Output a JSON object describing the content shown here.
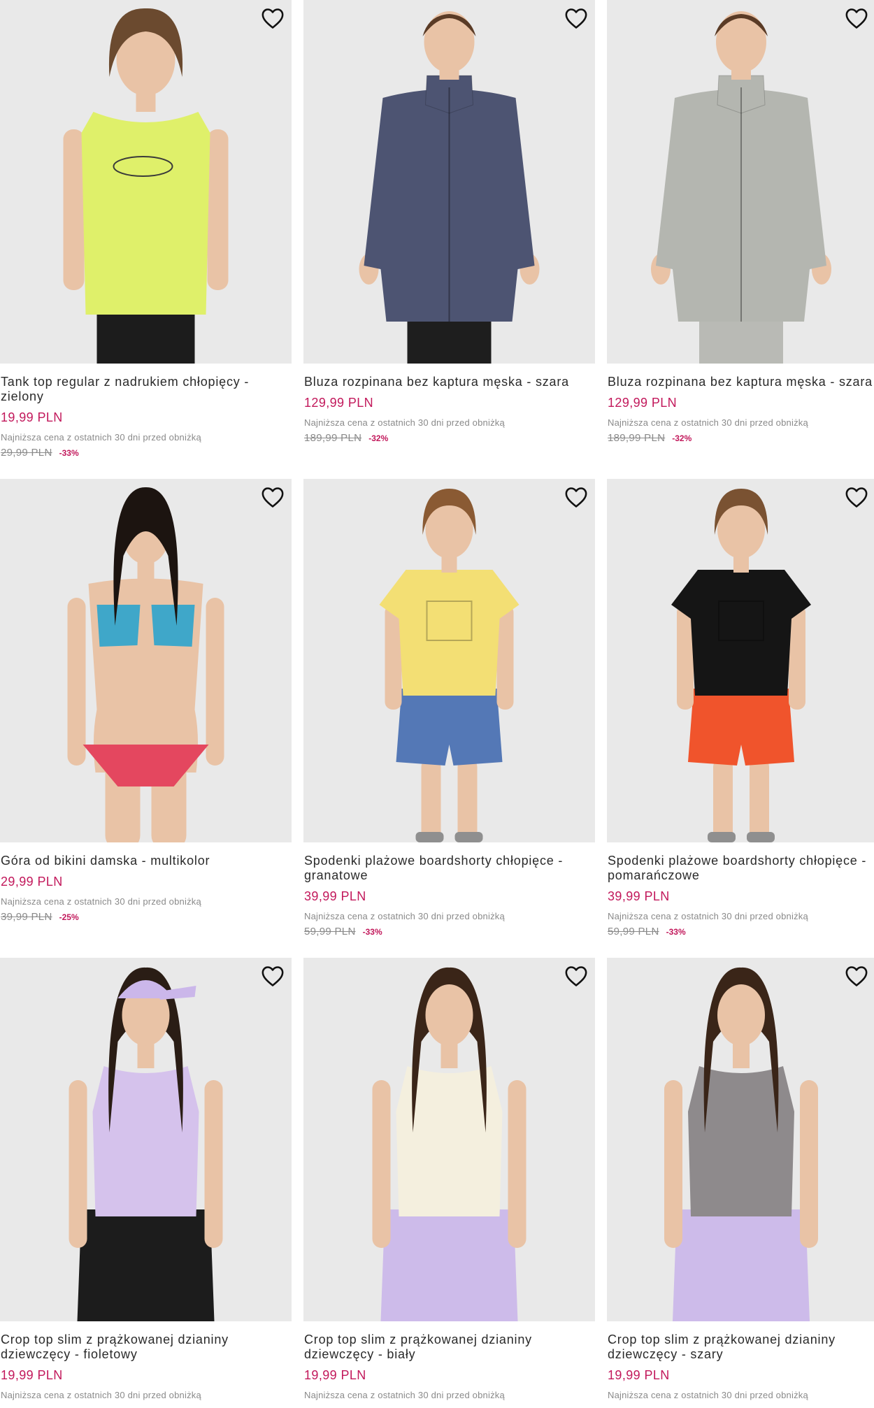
{
  "products": [
    {
      "title": "Tank top regular z nadrukiem chłopięcy - zielony",
      "price": "19,99 PLN",
      "lowest_label": "Najniższa cena z ostatnich 30 dni przed obniżką",
      "old_price": "29,99 PLN",
      "discount": "-33%",
      "image_kind": "kid-tank",
      "top_color": "#dff06a",
      "bottom_color": "#1c1c1c",
      "hair_color": "#6b4a2f"
    },
    {
      "title": "Bluza rozpinana bez kaptura męska - szara",
      "price": "129,99 PLN",
      "lowest_label": "Najniższa cena z ostatnich 30 dni przed obniżką",
      "old_price": "189,99 PLN",
      "discount": "-32%",
      "image_kind": "man-jacket",
      "top_color": "#4d5472",
      "bottom_color": "#1e1e1e",
      "hair_color": "#5a3b26"
    },
    {
      "title": "Bluza rozpinana bez kaptura męska - szara",
      "price": "129,99 PLN",
      "lowest_label": "Najniższa cena z ostatnich 30 dni przed obniżką",
      "old_price": "189,99 PLN",
      "discount": "-32%",
      "image_kind": "man-jacket",
      "top_color": "#b4b6b0",
      "bottom_color": "#b9bab5",
      "hair_color": "#5a3b26"
    },
    {
      "title": "Góra od bikini damska - multikolor",
      "price": "29,99 PLN",
      "lowest_label": "Najniższa cena z ostatnich 30 dni przed obniżką",
      "old_price": "39,99 PLN",
      "discount": "-25%",
      "image_kind": "bikini",
      "top_color": "#3fa7c9",
      "bottom_color": "#e4475f",
      "hair_color": "#1c1410"
    },
    {
      "title": "Spodenki plażowe boardshorty chłopięce - granatowe",
      "price": "39,99 PLN",
      "lowest_label": "Najniższa cena z ostatnich 30 dni przed obniżką",
      "old_price": "59,99 PLN",
      "discount": "-33%",
      "image_kind": "kid-tee-shorts",
      "top_color": "#f3df74",
      "bottom_color": "#5478b6",
      "hair_color": "#8a5a33"
    },
    {
      "title": "Spodenki plażowe boardshorty chłopięce - pomarańczowe",
      "price": "39,99 PLN",
      "lowest_label": "Najniższa cena z ostatnich 30 dni przed obniżką",
      "old_price": "59,99 PLN",
      "discount": "-33%",
      "image_kind": "kid-tee-shorts",
      "top_color": "#151515",
      "bottom_color": "#f0542c",
      "hair_color": "#7a5232"
    },
    {
      "title": "Crop top slim z prążkowanej dzianiny dziewczęcy - fioletowy",
      "price": "19,99 PLN",
      "lowest_label": "Najniższa cena z ostatnich 30 dni przed obniżką",
      "image_kind": "girl-tank",
      "top_color": "#d5c2ec",
      "bottom_color": "#1c1c1c",
      "hair_color": "#2a1d15",
      "cap_color": "#cbb7ea"
    },
    {
      "title": "Crop top slim z prążkowanej dzianiny dziewczęcy - biały",
      "price": "19,99 PLN",
      "lowest_label": "Najniższa cena z ostatnich 30 dni przed obniżką",
      "image_kind": "girl-tank",
      "top_color": "#f4efde",
      "bottom_color": "#cdbbea",
      "hair_color": "#3a2518"
    },
    {
      "title": "Crop top slim z prążkowanej dzianiny dziewczęcy - szary",
      "price": "19,99 PLN",
      "lowest_label": "Najniższa cena z ostatnich 30 dni przed obniżką",
      "image_kind": "girl-tank",
      "top_color": "#8e8a8c",
      "bottom_color": "#cdbbea",
      "hair_color": "#3a2518"
    }
  ],
  "icons": {
    "wishlist": "heart-outline-icon"
  },
  "colors": {
    "price_accent": "#c2185b",
    "muted_text": "#8a8a8a",
    "image_bg": "#e9e9e9"
  }
}
